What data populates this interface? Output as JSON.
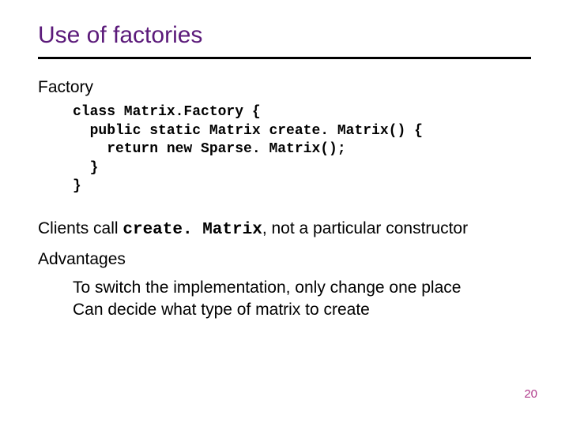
{
  "slide": {
    "title": "Use of factories",
    "section_label": "Factory",
    "code": "class Matrix.Factory {\n  public static Matrix create. Matrix() {\n    return new Sparse. Matrix();\n  }\n}",
    "clients_prefix": "Clients call ",
    "clients_code": "create. Matrix",
    "clients_suffix": ", not a particular constructor",
    "advantages_label": "Advantages",
    "advantage_1": "To switch the implementation, only change one place",
    "advantage_2": "Can decide what type of matrix to create",
    "page_number": "20"
  }
}
